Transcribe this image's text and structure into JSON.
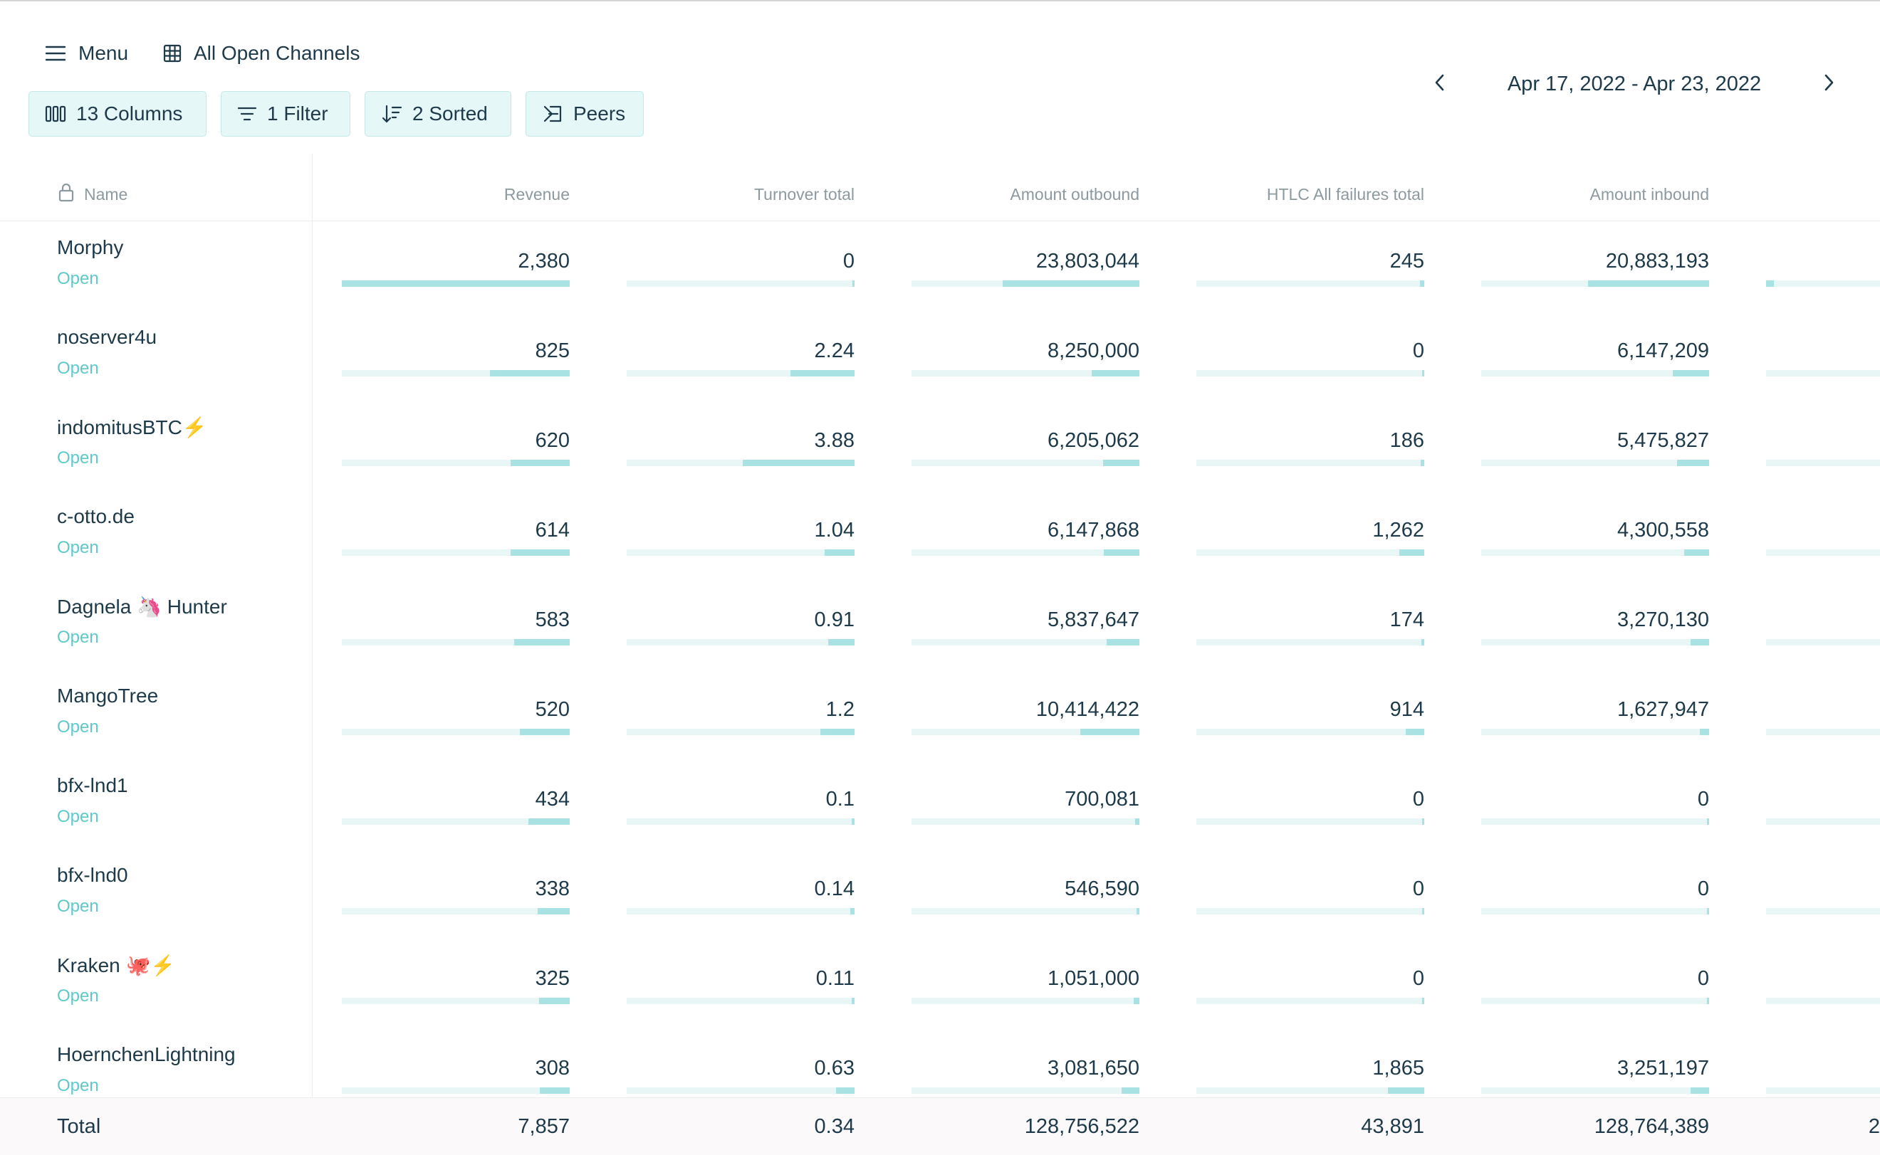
{
  "nav": {
    "menu_label": "Menu",
    "view_label": "All Open Channels"
  },
  "toolbar": {
    "columns_label": "13 Columns",
    "filter_label": "1 Filter",
    "sort_label": "2 Sorted",
    "peers_label": "Peers"
  },
  "date_range": {
    "label": "Apr 17, 2022 - Apr 23, 2022"
  },
  "table": {
    "name_header": "Name",
    "columns": [
      "Revenue",
      "Turnover total",
      "Amount outbound",
      "HTLC All failures total",
      "Amount inbound"
    ],
    "rows": [
      {
        "name": "Morphy",
        "status": "Open",
        "values": [
          "2,380",
          "0",
          "23,803,044",
          "245",
          "20,883,193"
        ],
        "bars": [
          1.0,
          0.0,
          0.6,
          0.02,
          0.53
        ],
        "extra_bar": 0.07
      },
      {
        "name": "noserver4u",
        "status": "Open",
        "values": [
          "825",
          "2.24",
          "8,250,000",
          "0",
          "6,147,209"
        ],
        "bars": [
          0.35,
          0.28,
          0.21,
          0.0,
          0.16
        ],
        "extra_bar": 0.0
      },
      {
        "name": "indomitusBTC⚡",
        "status": "Open",
        "values": [
          "620",
          "3.88",
          "6,205,062",
          "186",
          "5,475,827"
        ],
        "bars": [
          0.26,
          0.49,
          0.16,
          0.015,
          0.14
        ],
        "extra_bar": 0.0
      },
      {
        "name": "c-otto.de",
        "status": "Open",
        "values": [
          "614",
          "1.04",
          "6,147,868",
          "1,262",
          "4,300,558"
        ],
        "bars": [
          0.26,
          0.13,
          0.155,
          0.11,
          0.11
        ],
        "extra_bar": 0.0
      },
      {
        "name": "Dagnela 🦄 Hunter",
        "status": "Open",
        "values": [
          "583",
          "0.91",
          "5,837,647",
          "174",
          "3,270,130"
        ],
        "bars": [
          0.245,
          0.115,
          0.145,
          0.014,
          0.08
        ],
        "extra_bar": 0.0
      },
      {
        "name": "MangoTree",
        "status": "Open",
        "values": [
          "520",
          "1.2",
          "10,414,422",
          "914",
          "1,627,947"
        ],
        "bars": [
          0.22,
          0.15,
          0.26,
          0.08,
          0.04
        ],
        "extra_bar": 0.0
      },
      {
        "name": "bfx-lnd1",
        "status": "Open",
        "values": [
          "434",
          "0.1",
          "700,081",
          "0",
          "0"
        ],
        "bars": [
          0.18,
          0.013,
          0.018,
          0.0,
          0.0
        ],
        "extra_bar": 0.0
      },
      {
        "name": "bfx-lnd0",
        "status": "Open",
        "values": [
          "338",
          "0.14",
          "546,590",
          "0",
          "0"
        ],
        "bars": [
          0.14,
          0.018,
          0.014,
          0.0,
          0.0
        ],
        "extra_bar": 0.0
      },
      {
        "name": "Kraken 🐙⚡",
        "status": "Open",
        "values": [
          "325",
          "0.11",
          "1,051,000",
          "0",
          "0"
        ],
        "bars": [
          0.135,
          0.014,
          0.026,
          0.0,
          0.0
        ],
        "extra_bar": 0.0
      },
      {
        "name": "HoernchenLightning",
        "status": "Open",
        "values": [
          "308",
          "0.63",
          "3,081,650",
          "1,865",
          "3,251,197"
        ],
        "bars": [
          0.13,
          0.08,
          0.077,
          0.16,
          0.08
        ],
        "extra_bar": 0.0
      }
    ],
    "total": {
      "label": "Total",
      "values": [
        "7,857",
        "0.34",
        "128,756,522",
        "43,891",
        "128,764,389"
      ],
      "extra_value": "2"
    }
  },
  "colors": {
    "accent": "#5fc9c9",
    "bar_fill": "#a8e2e2",
    "bar_track": "#e9f6f6",
    "text": "#1e3a4a",
    "muted": "#8c9aa0"
  }
}
